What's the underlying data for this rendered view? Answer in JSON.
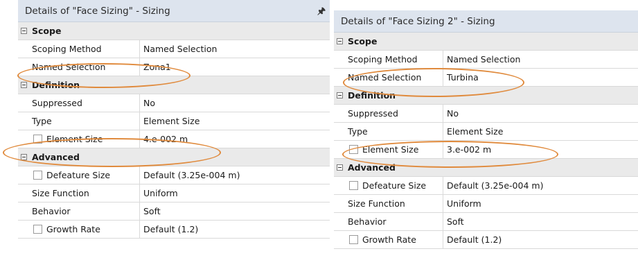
{
  "left_panel": {
    "title": "Details of \"Face Sizing\" - Sizing",
    "pin_icon": "pin-icon",
    "scope": {
      "label": "Scope",
      "scoping_method": {
        "name": "Scoping Method",
        "value": "Named Selection"
      },
      "named_selection": {
        "name": "Named Selection",
        "value": "Zona1"
      }
    },
    "definition": {
      "label": "Definition",
      "suppressed": {
        "name": "Suppressed",
        "value": "No"
      },
      "type": {
        "name": "Type",
        "value": "Element Size"
      },
      "element_size": {
        "name": "Element Size",
        "value": "4.e-002 m"
      }
    },
    "advanced": {
      "label": "Advanced",
      "defeature_size": {
        "name": "Defeature Size",
        "value": "Default (3.25e-004 m)"
      },
      "size_function": {
        "name": "Size Function",
        "value": "Uniform"
      },
      "behavior": {
        "name": "Behavior",
        "value": "Soft"
      },
      "growth_rate": {
        "name": "Growth Rate",
        "value": "Default (1.2)"
      }
    }
  },
  "right_panel": {
    "title": "Details of \"Face Sizing 2\" - Sizing",
    "scope": {
      "label": "Scope",
      "scoping_method": {
        "name": "Scoping Method",
        "value": "Named Selection"
      },
      "named_selection": {
        "name": "Named Selection",
        "value": "Turbina"
      }
    },
    "definition": {
      "label": "Definition",
      "suppressed": {
        "name": "Suppressed",
        "value": "No"
      },
      "type": {
        "name": "Type",
        "value": "Element Size"
      },
      "element_size": {
        "name": "Element Size",
        "value": "3.e-002 m"
      }
    },
    "advanced": {
      "label": "Advanced",
      "defeature_size": {
        "name": "Defeature Size",
        "value": "Default (3.25e-004 m)"
      },
      "size_function": {
        "name": "Size Function",
        "value": "Uniform"
      },
      "behavior": {
        "name": "Behavior",
        "value": "Soft"
      },
      "growth_rate": {
        "name": "Growth Rate",
        "value": "Default (1.2)"
      }
    }
  },
  "colors": {
    "title_bar": "#dde4ee",
    "group_row": "#eaeaea",
    "highlight_oval": "#e08a3c"
  }
}
